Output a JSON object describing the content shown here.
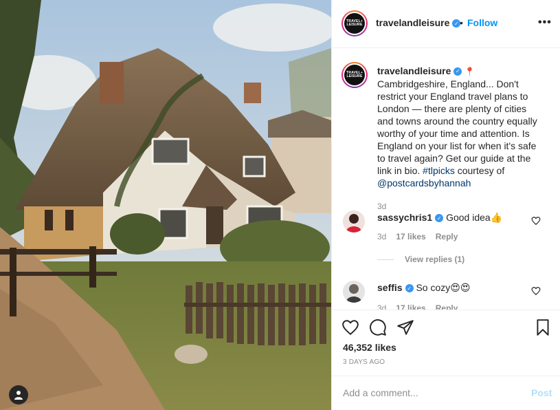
{
  "post": {
    "account": {
      "username": "travelandleisure",
      "avatar_text": "TRAVEL+ LEISURE"
    },
    "header": {
      "dot": "•",
      "follow_label": "Follow",
      "more_icon": "more-horizontal-icon",
      "more_glyph": "•••"
    },
    "caption": {
      "username": "travelandleisure",
      "location_icon": "round-pushpin-icon",
      "body": "Cambridgeshire, England... Don't restrict your England travel plans to London — there are plenty of cities and towns around the country equally worthy of your time and attention. Is England on your list for when it's safe to travel again? Get our guide at the link in bio.",
      "hashtag": "#tlpicks",
      "credit_prefix": "courtesy of",
      "credit_handle": "@postcardsbyhannah",
      "time": "3d"
    },
    "comments": [
      {
        "username": "sassychris1",
        "text": "Good idea",
        "emoji": "👍",
        "time": "3d",
        "likes": "17 likes",
        "reply_label": "Reply"
      },
      {
        "username": "seffis",
        "text": "So cozy",
        "emoji": "😍😍",
        "time": "3d",
        "likes": "17 likes",
        "reply_label": "Reply"
      }
    ],
    "view_replies": "View replies (1)",
    "actions": {
      "icons": [
        "heart-icon",
        "comment-icon",
        "share-icon",
        "bookmark-icon"
      ]
    },
    "likes": "46,352 likes",
    "posted": "3 DAYS AGO",
    "add_comment": {
      "placeholder": "Add a comment...",
      "post_label": "Post"
    },
    "colors": {
      "accent": "#0095f6",
      "verified": "#3897f0",
      "post_disabled": "#b2dffc",
      "muted": "#8e8e8e"
    }
  }
}
